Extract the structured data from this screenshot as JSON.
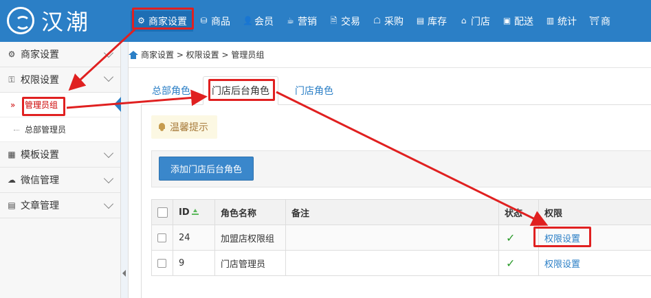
{
  "brand": {
    "name": "汉潮"
  },
  "nav": [
    {
      "label": "商家设置",
      "icon": "gear-icon",
      "glyph": "⚙"
    },
    {
      "label": "商品",
      "icon": "database-icon",
      "glyph": "⛁"
    },
    {
      "label": "会员",
      "icon": "user-icon",
      "glyph": "👤"
    },
    {
      "label": "营销",
      "icon": "cup-icon",
      "glyph": "☕"
    },
    {
      "label": "交易",
      "icon": "document-icon",
      "glyph": "🗎"
    },
    {
      "label": "采购",
      "icon": "cart-icon",
      "glyph": "☖"
    },
    {
      "label": "库存",
      "icon": "storage-icon",
      "glyph": "▤"
    },
    {
      "label": "门店",
      "icon": "home-icon",
      "glyph": "⌂"
    },
    {
      "label": "配送",
      "icon": "truck-icon",
      "glyph": "▣"
    },
    {
      "label": "统计",
      "icon": "bar-chart-icon",
      "glyph": "▥"
    },
    {
      "label": "商",
      "icon": "shop-icon",
      "glyph": "⛩"
    }
  ],
  "sidebar": {
    "groups": [
      {
        "label": "商家设置",
        "icon": "gear-icon",
        "glyph": "⚙"
      },
      {
        "label": "权限设置",
        "icon": "key-icon",
        "glyph": "⚿"
      },
      {
        "label": "模板设置",
        "icon": "template-icon",
        "glyph": "▦"
      },
      {
        "label": "微信管理",
        "icon": "wechat-icon",
        "glyph": "☁"
      },
      {
        "label": "文章管理",
        "icon": "article-icon",
        "glyph": "▤"
      }
    ],
    "sub_items": [
      {
        "label": "管理员组",
        "marker": "»"
      },
      {
        "label": "总部管理员"
      }
    ]
  },
  "breadcrumb": {
    "text": "商家设置 > 权限设置 > 管理员组"
  },
  "tabs": [
    {
      "label": "总部角色"
    },
    {
      "label": "门店后台角色"
    },
    {
      "label": "门店角色"
    }
  ],
  "tips": {
    "label": "温馨提示"
  },
  "toolbar": {
    "add_button": "添加门店后台角色"
  },
  "table": {
    "headers": {
      "id": "ID",
      "name": "角色名称",
      "note": "备注",
      "status": "状态",
      "permission": "权限"
    },
    "rows": [
      {
        "id": "24",
        "name": "加盟店权限组",
        "note": "",
        "status": "✓",
        "permission": "权限设置"
      },
      {
        "id": "9",
        "name": "门店管理员",
        "note": "",
        "status": "✓",
        "permission": "权限设置"
      }
    ]
  },
  "colors": {
    "primary": "#2b7fc6",
    "annotation_red": "#e02020",
    "success": "#2a9a2a",
    "tips_bg": "#fcf8e3"
  }
}
